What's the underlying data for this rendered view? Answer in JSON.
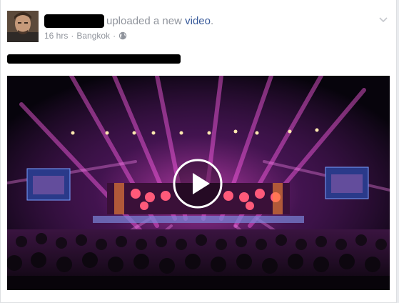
{
  "post": {
    "headline_text": "uploaded a new",
    "headline_link": "video",
    "headline_period": ".",
    "time": "16 hrs",
    "separator": "·",
    "location": "Bangkok",
    "separator2": "·",
    "privacy_icon": "globe-icon",
    "menu_icon": "chevron-down-icon",
    "video_control_icon": "play-icon"
  },
  "colors": {
    "link": "#365899",
    "muted": "#90949c",
    "border": "#dddfe2"
  }
}
